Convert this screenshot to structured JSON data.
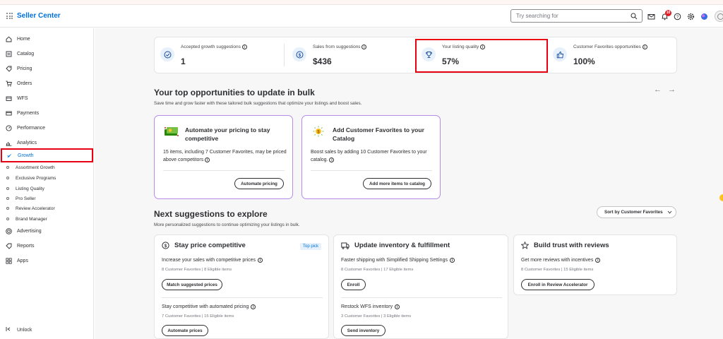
{
  "header": {
    "brand": "Seller Center",
    "search_placeholder": "Try searching for",
    "notification_count": "10",
    "icons": [
      "apps-grid-icon",
      "search-icon",
      "mail-icon",
      "bell-icon",
      "help-icon",
      "settings-icon",
      "assistant-icon",
      "avatar"
    ]
  },
  "sidebar": {
    "items": [
      {
        "label": "Home",
        "icon": "home-icon"
      },
      {
        "label": "Catalog",
        "icon": "catalog-icon"
      },
      {
        "label": "Pricing",
        "icon": "tag-icon"
      },
      {
        "label": "Orders",
        "icon": "cart-icon"
      },
      {
        "label": "WFS",
        "icon": "truck-icon"
      },
      {
        "label": "Payments",
        "icon": "card-icon"
      },
      {
        "label": "Performance",
        "icon": "gauge-icon"
      },
      {
        "label": "Analytics",
        "icon": "chart-icon"
      },
      {
        "label": "Growth",
        "icon": "rocket-icon",
        "active": true
      }
    ],
    "growth_subitems": [
      "Assortment Growth",
      "Exclusive Programs",
      "Listing Quality",
      "Pro Seller",
      "Review Accelerator",
      "Brand Manager"
    ],
    "bottom_items": [
      {
        "label": "Advertising",
        "icon": "ad-icon"
      },
      {
        "label": "Reports",
        "icon": "report-icon"
      },
      {
        "label": "Apps",
        "icon": "apps-icon"
      }
    ],
    "unlock_label": "Unlock"
  },
  "stats": [
    {
      "label": "Accepted growth suggestions",
      "value": "1",
      "icon": "check-circle-icon"
    },
    {
      "label": "Sales from suggestions",
      "value": "$436",
      "icon": "dollar-icon"
    },
    {
      "label": "Your listing quality",
      "value": "57%",
      "icon": "trophy-icon"
    },
    {
      "label": "Customer Favorites opportunities",
      "value": "100%",
      "icon": "thumbs-up-icon"
    }
  ],
  "bulk": {
    "title": "Your top opportunities to update in bulk",
    "subtitle": "Save time and grow faster with these tailored bulk suggestions that optimize your listings and boost sales.",
    "cards": [
      {
        "title": "Automate your pricing to stay competitive",
        "desc": "15 items, including 7 Customer Favorites, may be priced above competitors",
        "button": "Automate pricing"
      },
      {
        "title": "Add Customer Favorites to your Catalog",
        "desc": "Boost sales by adding 10 Customer Favorites to your catalog.",
        "button": "Add more items to catalog"
      }
    ]
  },
  "next": {
    "title": "Next suggestions to explore",
    "subtitle": "More personalized suggestions to continue optimizing your listings in bulk.",
    "sort_label": "Sort by Customer Favorites",
    "cards": [
      {
        "title": "Stay price competitive",
        "badge": "Top pick",
        "items": [
          {
            "title": "Increase your sales with competitive prices",
            "meta": "8 Customer Favorites | 8 Eligible items",
            "button": "Match suggested prices"
          },
          {
            "title": "Stay competitive with automated pricing",
            "meta": "7 Customer Favorites | 15 Eligible items",
            "button": "Automate prices"
          }
        ]
      },
      {
        "title": "Update inventory & fulfillment",
        "items": [
          {
            "title": "Faster shipping with Simplified Shipping Settings",
            "meta": "8 Customer Favorites | 17 Eligible items",
            "button": "Enroll"
          },
          {
            "title": "Restock WFS inventory",
            "meta": "3 Customer Favorites | 3 Eligible items",
            "button": "Send inventory"
          }
        ]
      },
      {
        "title": "Build trust with reviews",
        "items": [
          {
            "title": "Get more reviews with incentives",
            "meta": "8 Customer Favorites | 15 Eligible items",
            "button": "Enroll in Review Accelerator"
          }
        ]
      }
    ]
  }
}
